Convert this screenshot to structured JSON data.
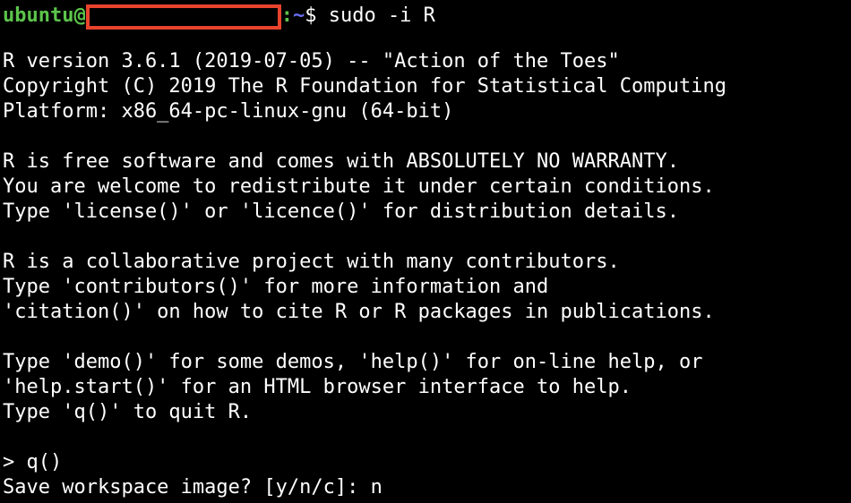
{
  "colors": {
    "background": "#000000",
    "text": "#ffffff",
    "user": "#5cc44b",
    "path": "#6a6ff2",
    "redaction_border": "#e8432d"
  },
  "prompt": {
    "user": "ubuntu@",
    "colon": ":",
    "path": "~",
    "symbol": "$",
    "command": " sudo -i R"
  },
  "output": {
    "version_line": "R version 3.6.1 (2019-07-05) -- \"Action of the Toes\"",
    "copyright_line": "Copyright (C) 2019 The R Foundation for Statistical Computing",
    "platform_line": "Platform: x86_64-pc-linux-gnu (64-bit)",
    "warranty_1": "R is free software and comes with ABSOLUTELY NO WARRANTY.",
    "warranty_2": "You are welcome to redistribute it under certain conditions.",
    "warranty_3": "Type 'license()' or 'licence()' for distribution details.",
    "collab_1": "R is a collaborative project with many contributors.",
    "collab_2": "Type 'contributors()' for more information and",
    "collab_3": "'citation()' on how to cite R or R packages in publications.",
    "help_1": "Type 'demo()' for some demos, 'help()' for on-line help, or",
    "help_2": "'help.start()' for an HTML browser interface to help.",
    "help_3": "Type 'q()' to quit R.",
    "r_command": "> q()",
    "save_prompt": "Save workspace image? [y/n/c]: n"
  }
}
